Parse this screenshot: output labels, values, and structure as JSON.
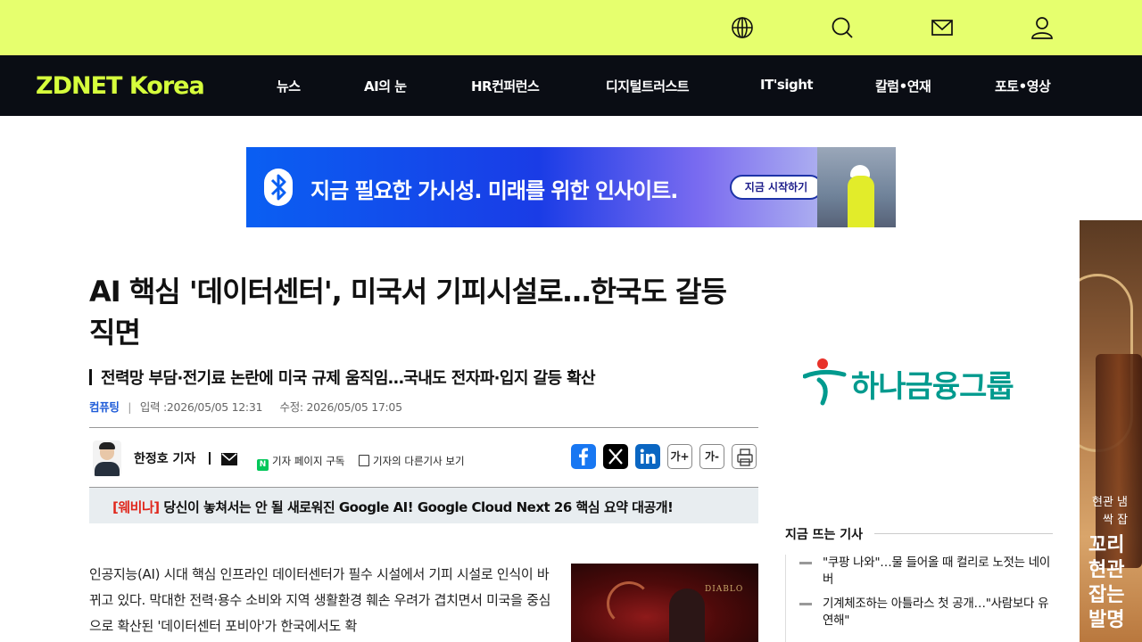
{
  "header": {
    "icons": [
      "globe-icon",
      "search-icon",
      "mail-icon",
      "user-icon"
    ]
  },
  "nav": {
    "logo": "ZDNET Korea",
    "items": [
      "뉴스",
      "AI의 눈",
      "HR컨퍼런스",
      "디지털트러스트",
      "IT'sight",
      "칼럼•연재",
      "포토•영상"
    ]
  },
  "top_banner": {
    "text": "지금 필요한 가시성. 미래를 위한 인사이트.",
    "button": "지금 시작하기"
  },
  "article": {
    "title": "AI 핵심 '데이터센터', 미국서 기피시설로…한국도 갈등 직면",
    "subtitle": "전력망 부담·전기료 논란에 미국 규제 움직임…국내도 전자파·입지 갈등 확산",
    "category": "컴퓨팅",
    "published": "입력 :2026/05/05 12:31",
    "modified": "수정: 2026/05/05 17:05",
    "author": "한정호 기자",
    "subscribe": "기자 페이지 구독",
    "other_articles": "기자의 다른기사 보기",
    "font_up": "가+",
    "font_down": "가-",
    "promo_tag": "[웨비나]",
    "promo_text": "당신이 놓쳐서는 안 될 새로워진 Google AI! Google Cloud Next 26 핵심 요약 대공개!",
    "body": "인공지능(AI) 시대 핵심 인프라인 데이터센터가 필수 시설에서 기피 시설로 인식이 바뀌고 있다. 막대한 전력·용수 소비와 지역 생활환경 훼손 우려가 겹치면서 미국을 중심으로 확산된 '데이터센터 포비아'가 한국에서도 확",
    "image_text": "DIABLO"
  },
  "sidebar": {
    "ad_text": "하나금융그룹",
    "trending_title": "지금 뜨는 기사",
    "trending": [
      "\"쿠팡 나와\"…물 들어올 때 컬리로 노젓는 네이버",
      "기계체조하는 아틀라스 첫 공개…\"사람보다 유연해\""
    ]
  },
  "side_ad": {
    "line1": "현관 냄",
    "line2": "싹 잡",
    "line3": "꼬리",
    "line4": "현관",
    "line5": "잡는 ",
    "line6": "발명"
  },
  "colors": {
    "topbar": "#e6ff6e",
    "navbar": "#0a0d14",
    "logo": "#d6ff3c",
    "category": "#1e5bd8",
    "promo_tag": "#e0271c",
    "hana": "#009a8e"
  }
}
